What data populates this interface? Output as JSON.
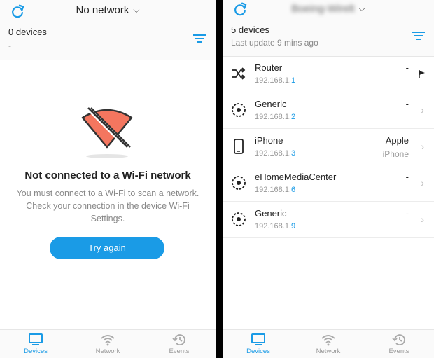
{
  "left": {
    "header": {
      "network_name": "No network",
      "device_count": "0 devices",
      "subtitle": "-"
    },
    "empty_state": {
      "title": "Not connected to a Wi-Fi network",
      "description": "You must connect to a Wi-Fi to scan a network. Check your connection in the device Wi-Fi Settings.",
      "button_label": "Try again"
    },
    "tabs": [
      {
        "label": "Devices",
        "icon": "desktop-icon",
        "active": true
      },
      {
        "label": "Network",
        "icon": "wifi-icon",
        "active": false
      },
      {
        "label": "Events",
        "icon": "history-icon",
        "active": false
      }
    ]
  },
  "right": {
    "header": {
      "network_name": "Boeing-Wirelt",
      "device_count": "5 devices",
      "subtitle": "Last update 9 mins ago"
    },
    "devices": [
      {
        "name": "Router",
        "ip_prefix": "192.168.1.",
        "ip_last": "1",
        "vendor": "-",
        "vendor_sub": "",
        "icon": "shuffle-icon",
        "arrow": "flag-icon"
      },
      {
        "name": "Generic",
        "ip_prefix": "192.168.1.",
        "ip_last": "2",
        "vendor": "-",
        "vendor_sub": "",
        "icon": "target-icon",
        "arrow": "chevron-right-icon"
      },
      {
        "name": "iPhone",
        "ip_prefix": "192.168.1.",
        "ip_last": "3",
        "vendor": "Apple",
        "vendor_sub": "iPhone",
        "icon": "phone-icon",
        "arrow": "chevron-right-icon"
      },
      {
        "name": "eHomeMediaCenter",
        "ip_prefix": "192.168.1.",
        "ip_last": "6",
        "vendor": "-",
        "vendor_sub": "",
        "icon": "target-icon",
        "arrow": "chevron-right-icon"
      },
      {
        "name": "Generic",
        "ip_prefix": "192.168.1.",
        "ip_last": "9",
        "vendor": "-",
        "vendor_sub": "",
        "icon": "target-icon",
        "arrow": "chevron-right-icon"
      }
    ],
    "tabs": [
      {
        "label": "Devices",
        "icon": "desktop-icon",
        "active": true
      },
      {
        "label": "Network",
        "icon": "wifi-icon",
        "active": false
      },
      {
        "label": "Events",
        "icon": "history-icon",
        "active": false
      }
    ]
  },
  "colors": {
    "accent": "#1a9be6",
    "warning_fill": "#f4765f",
    "separator": "#000000"
  }
}
